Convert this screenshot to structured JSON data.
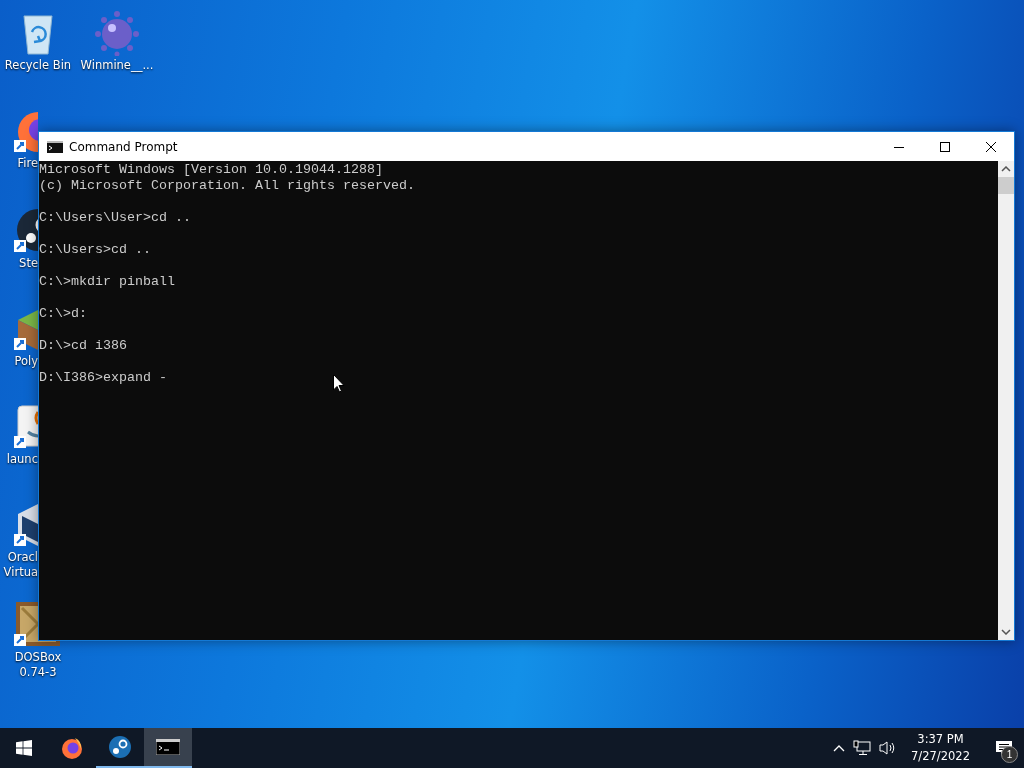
{
  "desktop": {
    "icons": [
      {
        "kind": "recycle-bin",
        "label": [
          "Recycle Bin"
        ]
      },
      {
        "kind": "mine",
        "label": [
          "Winmine__..."
        ]
      },
      {
        "kind": "firefox",
        "label": [
          "Fire"
        ]
      },
      {
        "kind": "steam",
        "label": [
          "Ste"
        ]
      },
      {
        "kind": "poly",
        "label": [
          "Poly"
        ]
      },
      {
        "kind": "java",
        "label": [
          "launc"
        ]
      },
      {
        "kind": "virtualbox",
        "label": [
          "Oracl",
          "Virtua"
        ]
      },
      {
        "kind": "dosbox",
        "label": [
          "DOSBox",
          "0.74-3"
        ]
      }
    ]
  },
  "window": {
    "title": "Command Prompt",
    "blocks": [
      [
        "Microsoft Windows [Version 10.0.19044.1288]",
        "(c) Microsoft Corporation. All rights reserved."
      ],
      [
        "C:\\Users\\User>cd .."
      ],
      [
        "C:\\Users>cd .."
      ],
      [
        "C:\\>mkdir pinball"
      ],
      [
        "C:\\>d:"
      ],
      [
        "D:\\>cd i386"
      ],
      [
        "D:\\I386>expand -"
      ]
    ]
  },
  "taskbar": {
    "apps": [
      {
        "kind": "firefox",
        "running": false,
        "selected": false
      },
      {
        "kind": "steam",
        "running": true,
        "selected": false
      },
      {
        "kind": "console",
        "running": true,
        "selected": true
      }
    ],
    "time": "3:37 PM",
    "date": "7/27/2022",
    "notification_count": "1"
  }
}
